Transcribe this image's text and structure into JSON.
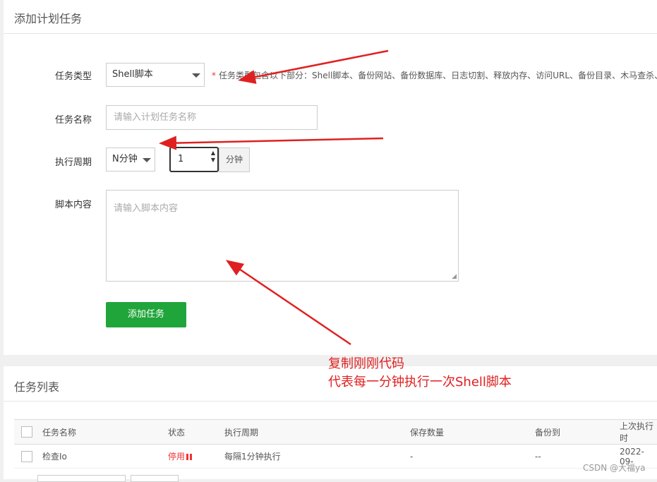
{
  "add_panel": {
    "title": "添加计划任务",
    "task_type": {
      "label": "任务类型",
      "value": "Shell脚本",
      "hint_star": "*",
      "hint": "任务类型包含以下部分：Shell脚本、备份网站、备份数据库、日志切割、释放内存、访问URL、备份目录、木马查杀、"
    },
    "task_name": {
      "label": "任务名称",
      "placeholder": "请输入计划任务名称"
    },
    "cycle": {
      "label": "执行周期",
      "period": "N分钟",
      "value": "1",
      "unit": "分钟"
    },
    "script": {
      "label": "脚本内容",
      "placeholder": "请输入脚本内容"
    },
    "submit_label": "添加任务"
  },
  "annotation": {
    "line1": "复制刚刚代码",
    "line2": "代表每一分钟执行一次Shell脚本",
    "color": "#e02020"
  },
  "list_panel": {
    "title": "任务列表",
    "columns": [
      "任务名称",
      "状态",
      "执行周期",
      "保存数量",
      "备份到",
      "上次执行时"
    ],
    "rows": [
      {
        "name": "检查Io",
        "status": "停用",
        "cycle": "每隔1分钟执行",
        "keep": "-",
        "backup": "--",
        "last_run": "2022-09-"
      }
    ]
  },
  "watermark": "CSDN @大福ya",
  "colors": {
    "primary_green": "#20a53a",
    "status_red": "#e33333"
  }
}
